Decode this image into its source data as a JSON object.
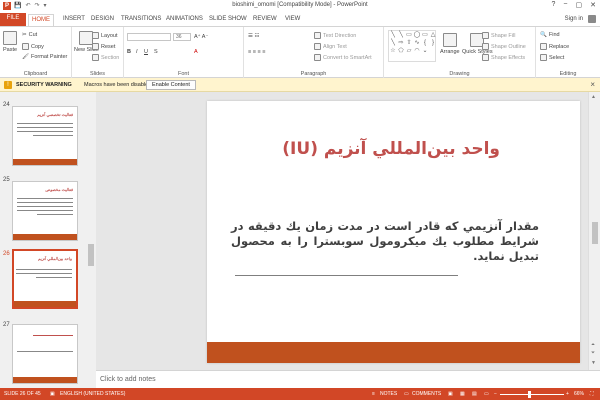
{
  "window": {
    "title": "bioshimi_omomi [Compatibility Mode] - PowerPoint",
    "app_glyph": "P",
    "controls": [
      "?",
      "−",
      "▢",
      "✕"
    ]
  },
  "qat": [
    "💾",
    "↶",
    "↷",
    "▾"
  ],
  "tabs": [
    {
      "label": "FILE"
    },
    {
      "label": "HOME"
    },
    {
      "label": "INSERT"
    },
    {
      "label": "DESIGN"
    },
    {
      "label": "TRANSITIONS"
    },
    {
      "label": "ANIMATIONS"
    },
    {
      "label": "SLIDE SHOW"
    },
    {
      "label": "REVIEW"
    },
    {
      "label": "VIEW"
    }
  ],
  "signin": "Sign in",
  "ribbon": {
    "clipboard": {
      "label": "Clipboard",
      "paste": "Paste",
      "cut": "Cut",
      "copy": "Copy",
      "format_painter": "Format Painter"
    },
    "slides": {
      "label": "Slides",
      "new_slide": "New Slide",
      "layout": "Layout",
      "reset": "Reset",
      "section": "Section"
    },
    "font": {
      "label": "Font",
      "size": "36"
    },
    "paragraph": {
      "label": "Paragraph",
      "text_direction": "Text Direction",
      "align_text": "Align Text",
      "convert": "Convert to SmartArt"
    },
    "drawing": {
      "label": "Drawing",
      "arrange": "Arrange",
      "quick_styles": "Quick Styles",
      "fill": "Shape Fill",
      "outline": "Shape Outline",
      "effects": "Shape Effects"
    },
    "editing": {
      "label": "Editing",
      "find": "Find",
      "replace": "Replace",
      "select": "Select"
    }
  },
  "security": {
    "title": "SECURITY WARNING",
    "message": "Macros have been disabled.",
    "button": "Enable Content"
  },
  "thumbnails": [
    {
      "num": "24",
      "title": "فعاليت تخصصي آنزيم"
    },
    {
      "num": "25",
      "title": "فعاليت مخصوص"
    },
    {
      "num": "26",
      "title": "واحد بين‌المللي آنزيم"
    },
    {
      "num": "27",
      "title": ""
    }
  ],
  "slide": {
    "title": "واحد بين‌المللي آنزيم (IU)",
    "body": "مقدار آنزيمي كه قادر است در مدت زمان يك دقيقه در شرايط مطلوب يك ميكرومول سوبسترا را به محصول تبديل نمايد."
  },
  "notes_placeholder": "Click to add notes",
  "status": {
    "slide_counter": "SLIDE 26 OF 45",
    "language": "ENGLISH (UNITED STATES)",
    "notes": "NOTES",
    "comments": "COMMENTS",
    "zoom": "66%"
  },
  "colors": {
    "accent": "#d24726",
    "title_red": "#c0504d",
    "band": "#c0511e"
  }
}
